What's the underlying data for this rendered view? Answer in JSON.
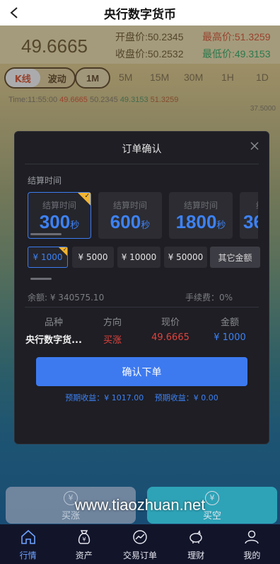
{
  "header": {
    "title": "央行数字货币"
  },
  "quote": {
    "price": "49.6665",
    "open_label": "开盘价:",
    "open": "50.2345",
    "high_label": "最高价:",
    "high": "51.3259",
    "close_label": "收盘价:",
    "close": "50.2532",
    "low_label": "最低价:",
    "low": "49.3153"
  },
  "chart_tabs": {
    "kline": "K线",
    "wave": "波动",
    "timeframes": [
      "1M",
      "5M",
      "15M",
      "30M",
      "1H",
      "1D"
    ]
  },
  "timeline": {
    "time": "Time:11:55:00",
    "v1": "49.6665",
    "v2": "50.2345",
    "v3": "49.3153",
    "v4": "51.3259",
    "axis": "37.5000"
  },
  "modal": {
    "title": "订单确认",
    "section_label": "结算时间",
    "durations": [
      {
        "label": "结算时间",
        "value": "300",
        "unit": "秒"
      },
      {
        "label": "结算时间",
        "value": "600",
        "unit": "秒"
      },
      {
        "label": "结算时间",
        "value": "1800",
        "unit": "秒"
      },
      {
        "label": "结",
        "value": "36",
        "unit": ""
      }
    ],
    "amounts": [
      "¥ 1000",
      "¥ 5000",
      "¥ 10000",
      "¥ 50000"
    ],
    "other_amount": "其它金额",
    "balance": "余额: ¥ 340575.10",
    "fee": "手续费：0%",
    "table": {
      "headers": [
        "品种",
        "方向",
        "现价",
        "金额"
      ],
      "row": [
        "央行数字货...",
        "买涨",
        "49.6665",
        "¥ 1000"
      ]
    },
    "confirm_label": "确认下单",
    "expected1": "预期收益：¥ 1017.00",
    "expected2": "预期收益：¥ 0.00"
  },
  "actions": {
    "buy": "买涨",
    "sell": "买空"
  },
  "watermark": "www.tiaozhuan.net",
  "nav": {
    "items": [
      {
        "label": "行情",
        "icon": "home-icon"
      },
      {
        "label": "资产",
        "icon": "money-bag-icon"
      },
      {
        "label": "交易订单",
        "icon": "chart-circle-icon"
      },
      {
        "label": "理财",
        "icon": "piggy-bank-icon"
      },
      {
        "label": "我的",
        "icon": "user-icon"
      }
    ]
  },
  "colors": {
    "accent": "#3d7af0",
    "rise": "#e0433d",
    "fall": "#3bb36b",
    "corner": "#f2b431"
  }
}
